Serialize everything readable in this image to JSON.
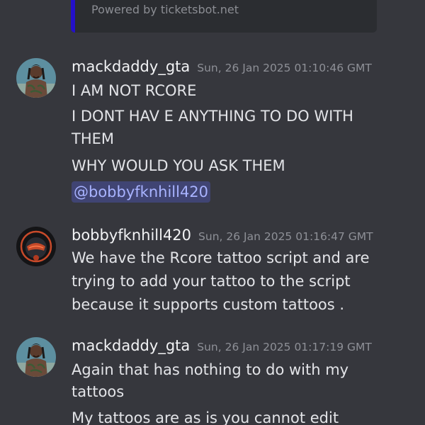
{
  "embed": {
    "footer": "Powered by ticketsbot.net",
    "accent_color": "#2410c9"
  },
  "messages": [
    {
      "username": "mackdaddy_gta",
      "timestamp": "Sun, 26 Jan 2025 01:10:46 GMT",
      "avatar": "tattooed-man-avatar",
      "lines": [
        "I AM NOT RCORE",
        "I DONT HAV E ANYTHING TO DO WITH",
        "THEM",
        "WHY WOULD YOU ASK THEM"
      ],
      "mention": "@bobbyfknhill420"
    },
    {
      "username": "bobbyfknhill420",
      "timestamp": "Sun, 26 Jan 2025 01:16:47 GMT",
      "avatar": "helmet-avatar",
      "lines": [
        "We have the Rcore tattoo script and are",
        "trying to add your tattoo to the script",
        "because it supports custom tattoos ."
      ]
    },
    {
      "username": "mackdaddy_gta",
      "timestamp": "Sun, 26 Jan 2025 01:17:19 GMT",
      "avatar": "tattooed-man-avatar",
      "lines": [
        "Again that has nothing to do with my",
        "tattoos",
        "My tattoos are as is you cannot edit"
      ]
    }
  ],
  "colors": {
    "background": "#36373d",
    "mention_text": "#a8b3ff"
  }
}
